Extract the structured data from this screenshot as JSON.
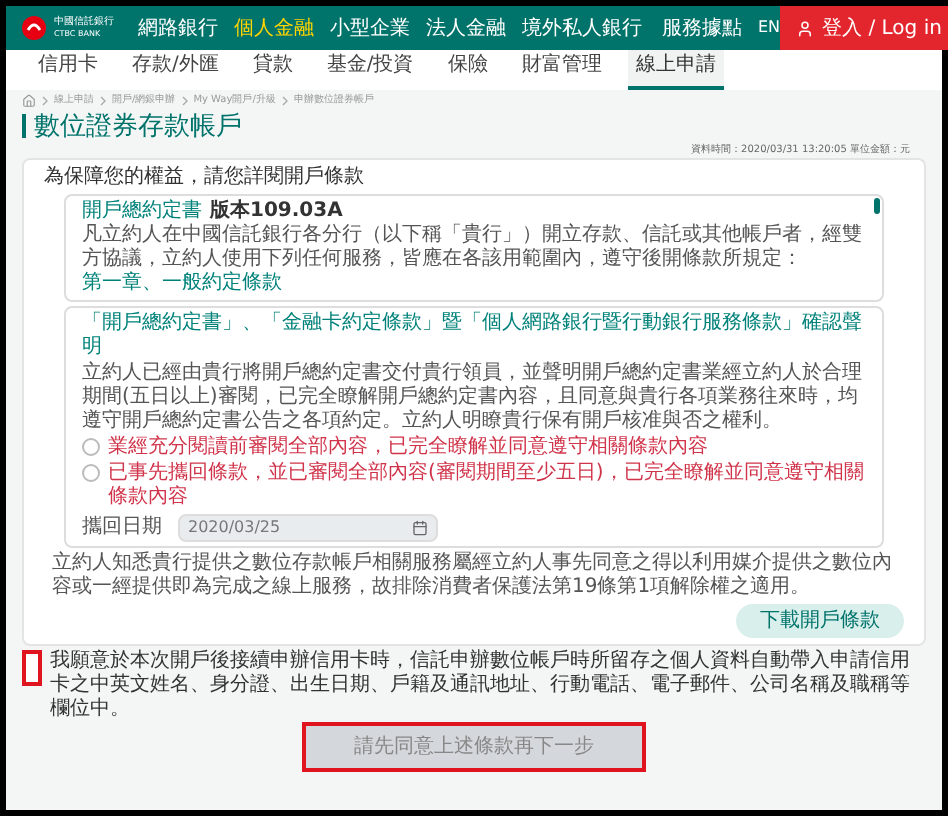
{
  "header": {
    "logo": {
      "name": "中國信託銀行",
      "sub": "CTBC BANK"
    },
    "nav": [
      {
        "label": "網路銀行",
        "selected": false
      },
      {
        "label": "個人金融",
        "selected": true
      },
      {
        "label": "小型企業",
        "selected": false
      },
      {
        "label": "法人金融",
        "selected": false
      },
      {
        "label": "境外私人銀行",
        "selected": false
      }
    ],
    "service": "服務據點",
    "lang": "EN",
    "login": "登入 / Log in"
  },
  "subnav": [
    {
      "label": "信用卡",
      "selected": false
    },
    {
      "label": "存款/外匯",
      "selected": false
    },
    {
      "label": "貸款",
      "selected": false
    },
    {
      "label": "基金/投資",
      "selected": false
    },
    {
      "label": "保險",
      "selected": false
    },
    {
      "label": "財富管理",
      "selected": false
    },
    {
      "label": "線上申請",
      "selected": true
    }
  ],
  "breadcrumb": [
    "線上申請",
    "開戶/網銀申辦",
    "My Way開戶/升級",
    "申辦數位證券帳戶"
  ],
  "title": "數位證券存款帳戶",
  "data_time": "資料時間：2020/03/31 13:20:05 單位金額：元",
  "terms": {
    "intro": "為保障您的權益，請您詳閱開戶條款",
    "doc": {
      "title": "開戶總約定書",
      "version": "版本109.03A",
      "body": "凡立約人在中國信託銀行各分行（以下稱「貴行」）開立存款、信託或其他帳戶者，經雙方協議，立約人使用下列任何服務，皆應在各該用範圍內，遵守後開條款所規定：",
      "chapter": "第一章、一般約定條款"
    },
    "confirm": {
      "heading": "「開戶總約定書」、「金融卡約定條款」暨「個人網路銀行暨行動銀行服務條款」確認聲明",
      "body": "立約人已經由貴行將開戶總約定書交付貴行領員，並聲明開戶總約定書業經立約人於合理期間(五日以上)審閱，已完全瞭解開戶總約定書內容，且同意與貴行各項業務往來時，均遵守開戶總約定書公告之各項約定。立約人明瞭貴行保有開戶核准與否之權利。",
      "options": [
        {
          "label": "業經充分閱讀前審閱全部內容，已完全瞭解並同意遵守相關條款內容",
          "selected": false
        },
        {
          "label": "已事先攜回條款，並已審閱全部內容(審閱期間至少五日)，已完全瞭解並同意遵守相關條款內容",
          "selected": false
        }
      ],
      "date": {
        "label": "攜回日期",
        "value": "2020/03/25"
      }
    },
    "notice": "立約人知悉貴行提供之數位存款帳戶相關服務屬經立約人事先同意之得以利用媒介提供之數位內容或一經提供即為完成之線上服務，故排除消費者保護法第19條第1項解除權之適用。",
    "download": "下載開戶條款"
  },
  "consent": {
    "checked": false,
    "highlighted": true,
    "text": "我願意於本次開戶後接續申辦信用卡時，信託申辦數位帳戶時所留存之個人資料自動帶入申請信用卡之中英文姓名、身分證、出生日期、戶籍及通訊地址、行動電話、電子郵件、公司名稱及職稱等欄位中。"
  },
  "next": {
    "label": "請先同意上述條款再下一步",
    "disabled": true,
    "highlighted": true
  }
}
